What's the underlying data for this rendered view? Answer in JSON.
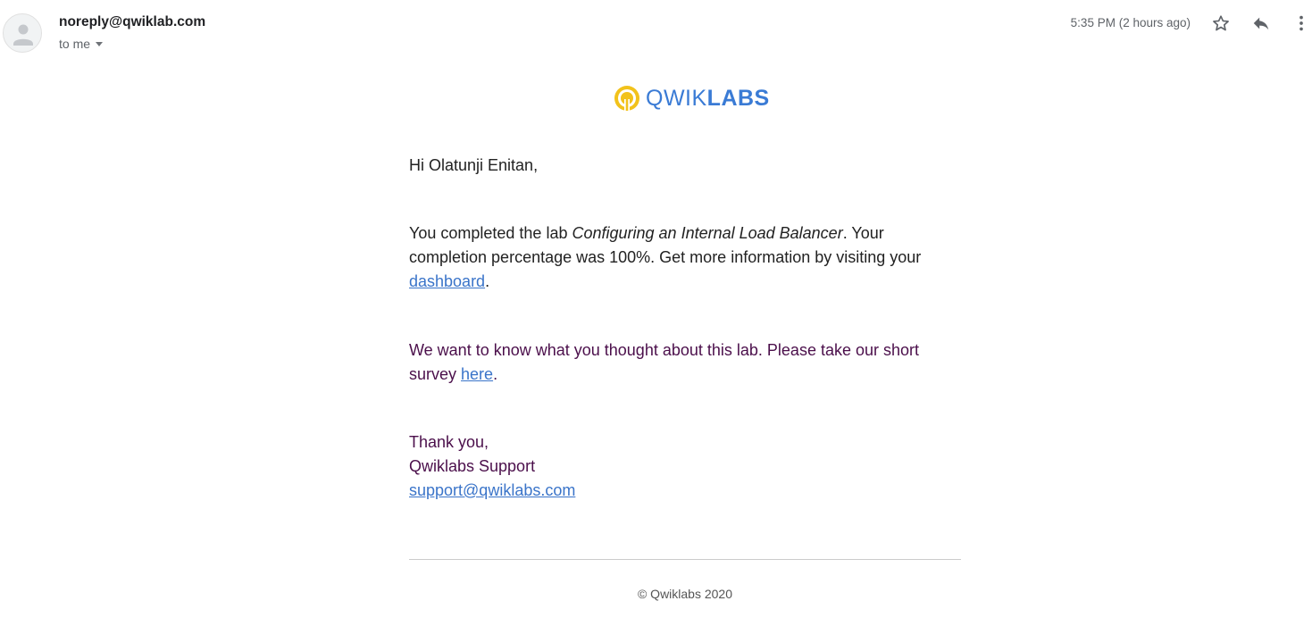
{
  "header": {
    "sender": "noreply@qwiklab.com",
    "recipient": "to me",
    "timestamp": "5:35 PM (2 hours ago)",
    "icons": {
      "avatar": "default-avatar-icon",
      "star": "star-outline-icon",
      "reply": "reply-icon",
      "more": "more-vert-icon",
      "recipient_caret": "caret-down-icon"
    }
  },
  "logo": {
    "word_light": "QWIK",
    "word_bold": "LABS",
    "colors": {
      "mark": "#F2C21B",
      "text": "#3A7BD5"
    }
  },
  "email": {
    "greeting": "Hi Olatunji Enitan,",
    "completion": {
      "text_before": "You completed the lab ",
      "lab_name": "Configuring an Internal Load Balancer",
      "text_after": ". Your completion percentage was 100%. Get more information by visiting your ",
      "link_text": "dashboard",
      "end": "."
    },
    "survey": {
      "text_before": "We want to know what you thought about this lab. Please take our short survey ",
      "link_text": "here",
      "end": "."
    },
    "signoff": {
      "thanks": "Thank you,",
      "team": "Qwiklabs Support",
      "email_link": "support@qwiklabs.com"
    }
  },
  "footer": {
    "copyright": "© Qwiklabs 2020"
  },
  "colors": {
    "link": "#3A74C9",
    "purple_text": "#4B0F4B",
    "body_text": "#222222",
    "divider": "#CCCCCC"
  }
}
